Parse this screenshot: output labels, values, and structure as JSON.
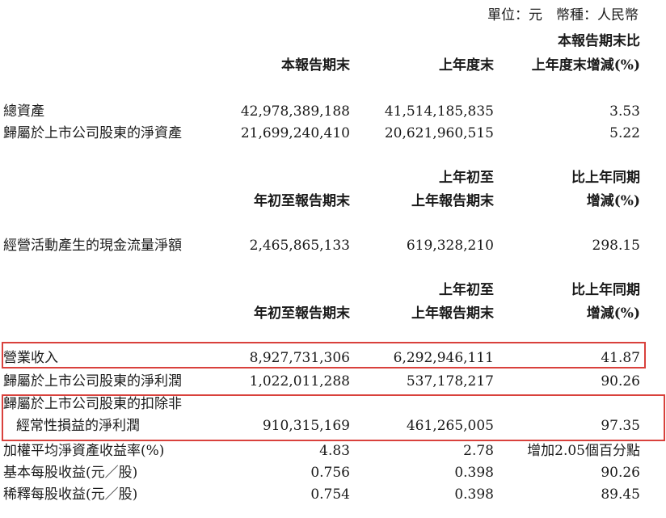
{
  "unit_line": "單位：元　幣種：人民幣",
  "section1": {
    "headers": {
      "col1": "本報告期末",
      "col2": "上年度末",
      "col3_line1": "本報告期末比",
      "col3_line2": "上年度末增減(%)"
    },
    "rows": [
      {
        "label": "總資產",
        "v1": "42,978,389,188",
        "v2": "41,514,185,835",
        "v3": "3.53"
      },
      {
        "label": "歸屬於上市公司股東的淨資產",
        "v1": "21,699,240,410",
        "v2": "20,621,960,515",
        "v3": "5.22"
      }
    ]
  },
  "section2": {
    "headers": {
      "col1": "年初至報告期末",
      "col2_line1": "上年初至",
      "col2_line2": "上年報告期末",
      "col3_line1": "比上年同期",
      "col3_line2": "增減(%)"
    },
    "rows": [
      {
        "label": "經營活動產生的現金流量淨額",
        "v1": "2,465,865,133",
        "v2": "619,328,210",
        "v3": "298.15"
      }
    ]
  },
  "section3": {
    "headers": {
      "col1": "年初至報告期末",
      "col2_line1": "上年初至",
      "col2_line2": "上年報告期末",
      "col3_line1": "比上年同期",
      "col3_line2": "增減(%)"
    },
    "rows": [
      {
        "label": "營業收入",
        "v1": "8,927,731,306",
        "v2": "6,292,946,111",
        "v3": "41.87"
      },
      {
        "label": "歸屬於上市公司股東的淨利潤",
        "v1": "1,022,011,288",
        "v2": "537,178,217",
        "v3": "90.26"
      },
      {
        "label_line1": "歸屬於上市公司股東的扣除非",
        "label_line2": "經常性損益的淨利潤",
        "v1": "910,315,169",
        "v2": "461,265,005",
        "v3": "97.35"
      },
      {
        "label": "加權平均淨資產收益率(%)",
        "v1": "4.83",
        "v2": "2.78",
        "v3": "增加2.05個百分點"
      },
      {
        "label": "基本每股收益(元／股)",
        "v1": "0.756",
        "v2": "0.398",
        "v3": "90.26"
      },
      {
        "label": "稀釋每股收益(元／股)",
        "v1": "0.754",
        "v2": "0.398",
        "v3": "89.45"
      }
    ]
  },
  "highlight_color": "#d9413c"
}
